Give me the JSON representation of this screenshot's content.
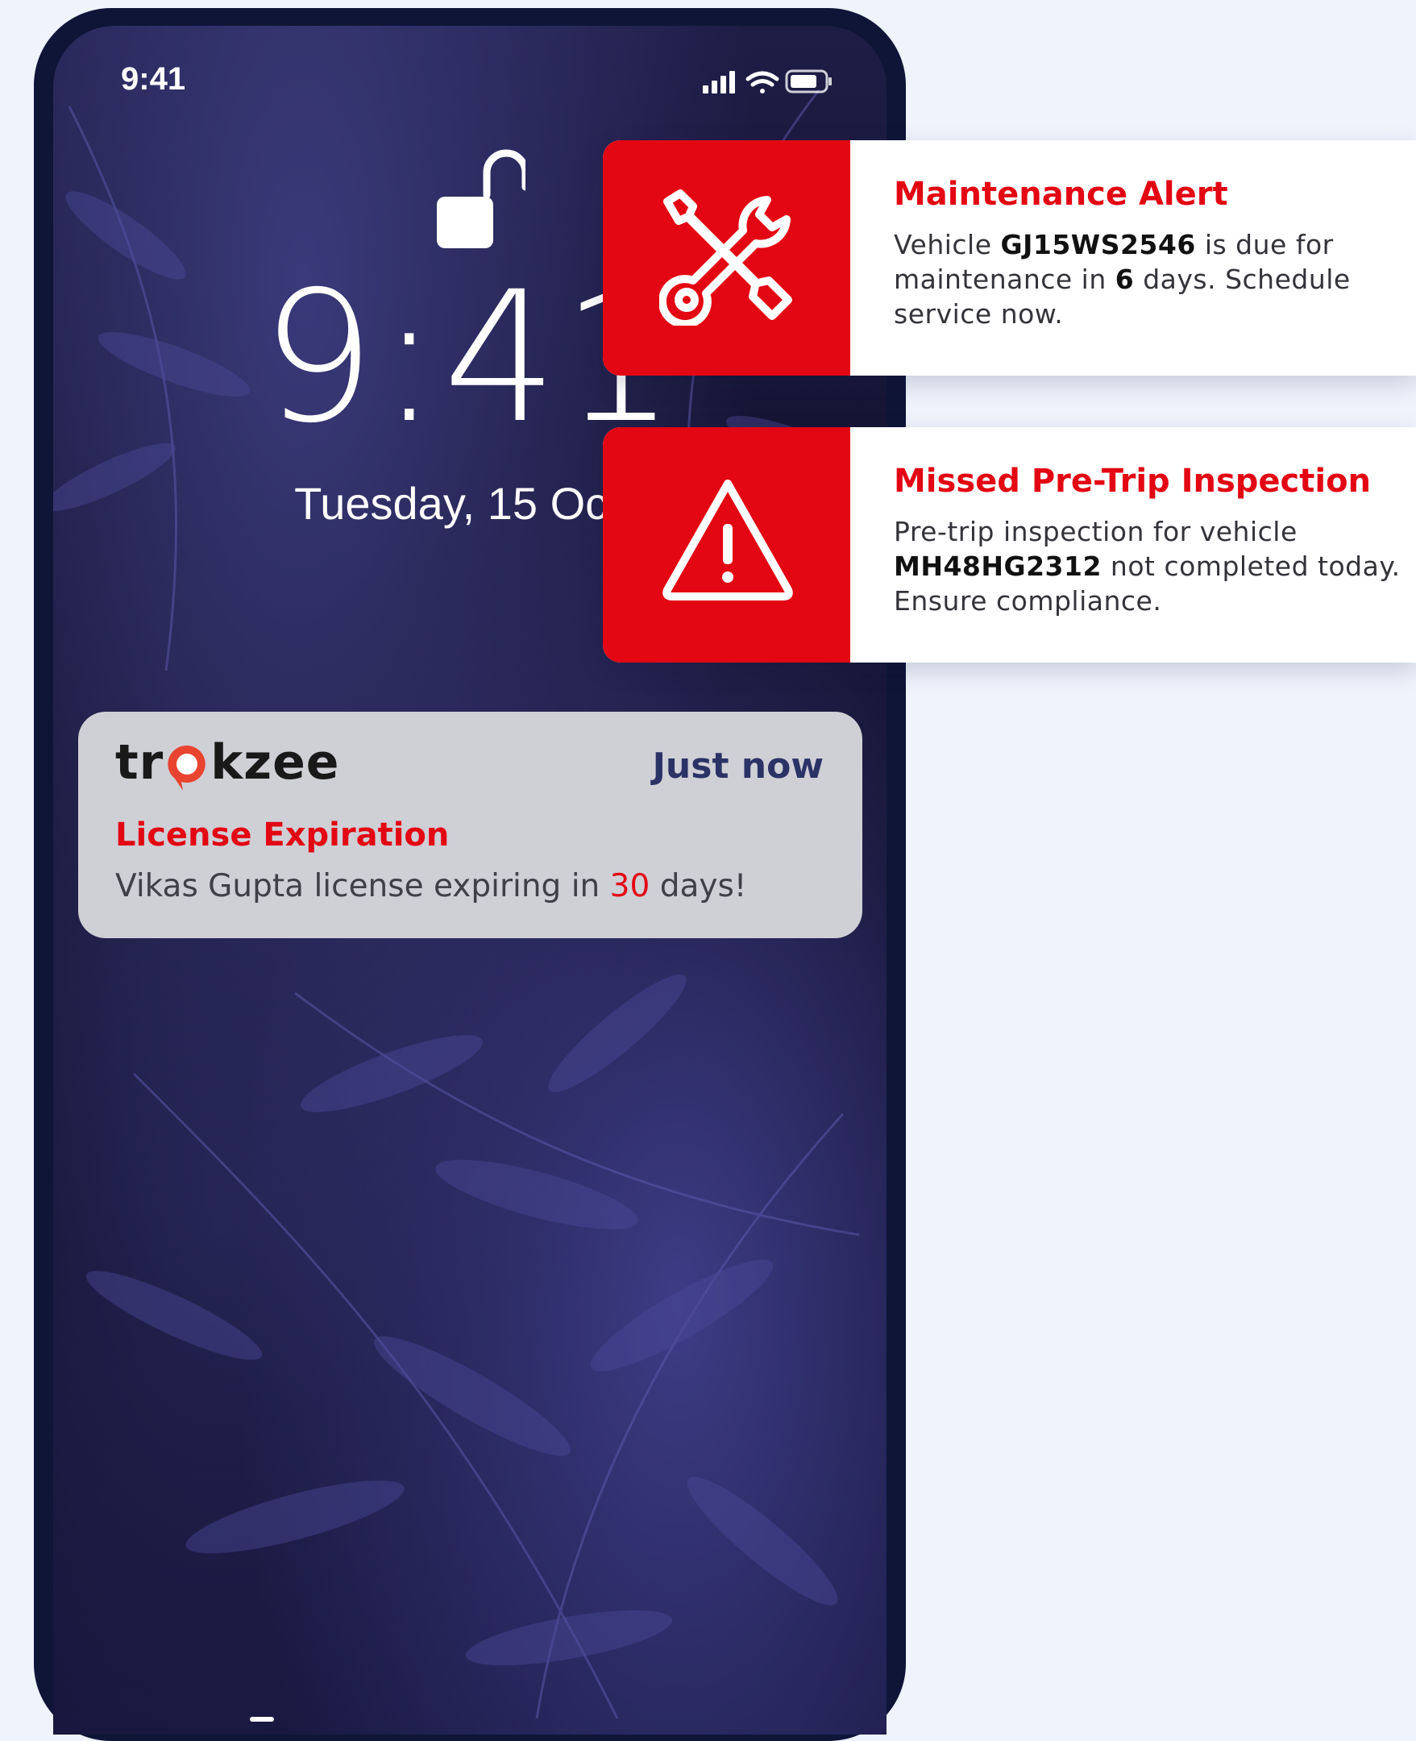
{
  "status_bar": {
    "time": "9:41",
    "icons": [
      "signal-icon",
      "wifi-icon",
      "battery-icon"
    ]
  },
  "lockscreen": {
    "clock": "9:41",
    "date": "Tuesday, 15 Octo"
  },
  "lock_notification": {
    "brand_prefix": "tr",
    "brand_suffix": "kzee",
    "time": "Just now",
    "title": "License Expiration",
    "body_before": "Vikas Gupta license expiring in ",
    "body_number": "30",
    "body_after": " days!"
  },
  "alerts": [
    {
      "title": "Maintenance Alert",
      "body_1": "Vehicle ",
      "vehicle": "GJ15WS2546",
      "body_2": "  is due for maintenance in ",
      "days": "6",
      "body_3": " days. Schedule service now.",
      "icon": "tools-icon"
    },
    {
      "title": "Missed Pre-Trip Inspection",
      "body_1": "Pre-trip inspection for vehicle ",
      "vehicle": "MH48HG2312",
      "body_2": " not completed today. Ensure compliance.",
      "icon": "warning-icon"
    }
  ],
  "colors": {
    "accent_red": "#e30613",
    "page_bg": "#eef3fc",
    "phone_frame": "#0f1537",
    "time_text": "#2b3366"
  }
}
